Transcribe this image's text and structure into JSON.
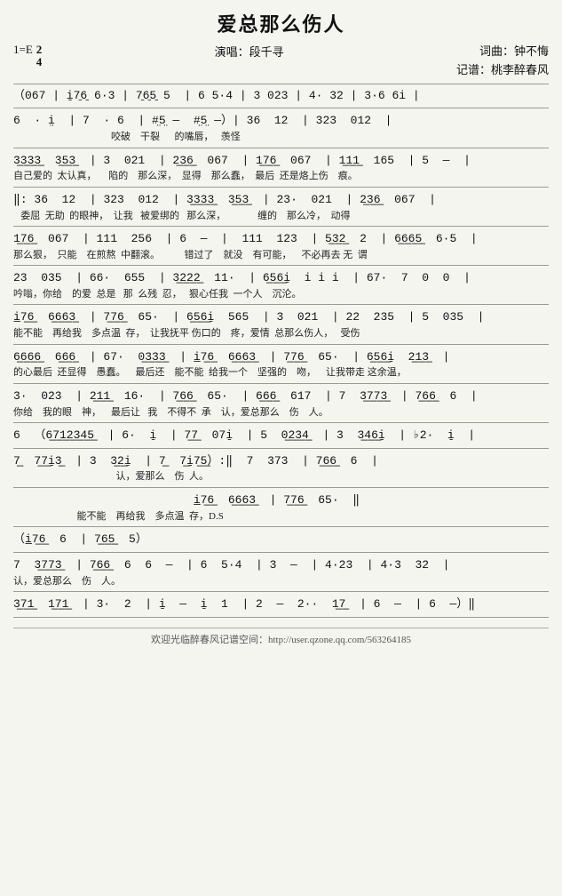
{
  "title": "爱总那么伤人",
  "key": "1=E",
  "time_num": "2",
  "time_den": "4",
  "singer_label": "演唱：段千寻",
  "composer_label": "词曲：钟不悔",
  "arranger_label": "记谱：桃李醉春风",
  "footer_text": "欢迎光临醉春风记谱空间：http://user.qzone.qq.com/563264185",
  "lines": [
    {
      "notes": "（067 | i̱7̱6̱ 6·3 | 7̱6̱5̱ 5  | 6 5·4 | 3 023 | 4· 32 | 3·6 6i |",
      "lyrics": ""
    },
    {
      "notes": "6  · i̤  | 7  · 6  | #̤5̤ —  #̤5̤ —）| 36  12  | 323  012  |",
      "lyrics": "                                        咬破    干裂      的嘴唇，   羡怪"
    },
    {
      "notes": "3̲3̲3̲3̲  3̲5̲3̲  | 3  021  | 2̲3̲6̲  067  | 1̲7̲6̲  067  | 1̲1̲1̲  165  | 5  —  |",
      "lyrics": "自己爱的  太认真，     陷的    那么深，  显得    那么蠢，  最后  还是烙上伤    痕。"
    },
    {
      "notes": "‖: 36  12  | 323  012  | 3̲3̲3̲3̲  3̲5̲3̲  | 23·  021  | 2̲3̲6̲  067  |",
      "lyrics": "   委屈  无助  的眼神，  让我   被爱绑的   那么深，             缠的    那么冷，  动得"
    },
    {
      "notes": "1̲7̲6̲  067  | 111  256  | 6  —  |  111  123  | 5̲3̲2̲  2  | 6̲6̲6̲5̲  6·5  |",
      "lyrics": "那么狠，  只能    在煎熬  中翻滚。          错过了    就没    有可能，    不必再去 无  谓"
    },
    {
      "notes": "23  035  | 66·  655  | 3̲2̲2̲2̲  11·  | 6̲5̲6̲i̱  i i i  | 67·  7  0  0  |",
      "lyrics": "吟嗡，你给    的爱  总是   那  么残  忍，   狠心任我  一个人    沉沦。"
    },
    {
      "notes": "i̲7̲6̲  6̲6̲6̲3̲  | 7̲7̲6̲  65·  | 6̲5̲6̲i̱  565  | 3  021  | 22  235  | 5  035  |",
      "lyrics": "能不能    再给我    多点温  存，  让我抚平 伤口的    疼，爱情  总那么伤人，   受伤"
    },
    {
      "notes": "6̲6̲6̲6̲  6̲6̲6̲  | 67·  0̲3̲3̲3̲  | i̲7̲6̲  6̲6̲6̲3̲  | 7̲7̲6̲  65·  | 6̲5̲6̲i̱  2̲1̲3̲  |",
      "lyrics": "的心最后  还显得    愚蠢。    最后还    能不能  给我一个    坚强的    吻，    让我带走 这余温，"
    },
    {
      "notes": "3·  023  | 2̲1̲1̲  16·  | 7̲6̲6̲  65·  | 6̲6̲6̲  617  | 7  3̲7̲7̲3̲  | 7̲6̲6̲  6  |",
      "lyrics": "你给    我的眼    神，    最后让   我    不得不  承    认，爱总那么    伤    人。"
    },
    {
      "notes": "6  （6̲7̲1̲2̲3̲4̲5̲  | 6·  i̱  | 7̲7̲  07i̱  | 5  0̲2̲3̲4̲  | 3  3̲4̲6̲i̱  | ♭2·  i̱  |",
      "lyrics": ""
    },
    {
      "notes": "7̲  7̲7̲i̱3̲  | 3  3̲2̲i̱  | 7̲  7̲i̱7̲5̲）:‖  7  373  | 7̲6̲6̲  6  |",
      "lyrics": "                                          认，爱那么    伤  人。"
    },
    {
      "notes": "                          i̲7̲6̲  6̲6̲6̲3̲  | 7̲7̲6̲  65·  ‖",
      "lyrics": "                          能不能    再给我    多点温  存，D.S"
    },
    {
      "notes": "（i̲7̲6̲  6  | 7̲6̲5̲  5）",
      "lyrics": ""
    },
    {
      "notes": "7  3̲7̲7̲3̲  | 7̲6̲6̲  6  6  —  | 6  5·4  | 3  —  | 4·23  | 4·3  32  |",
      "lyrics": "认，爱总那么    伤    人。"
    },
    {
      "notes": "3̲7̲1̲  1̲7̲1̲  | 3·  2  | i̱  —  i̱  1  | 2  —  2··  1̲7̲  | 6  —  | 6  —）‖",
      "lyrics": ""
    }
  ]
}
